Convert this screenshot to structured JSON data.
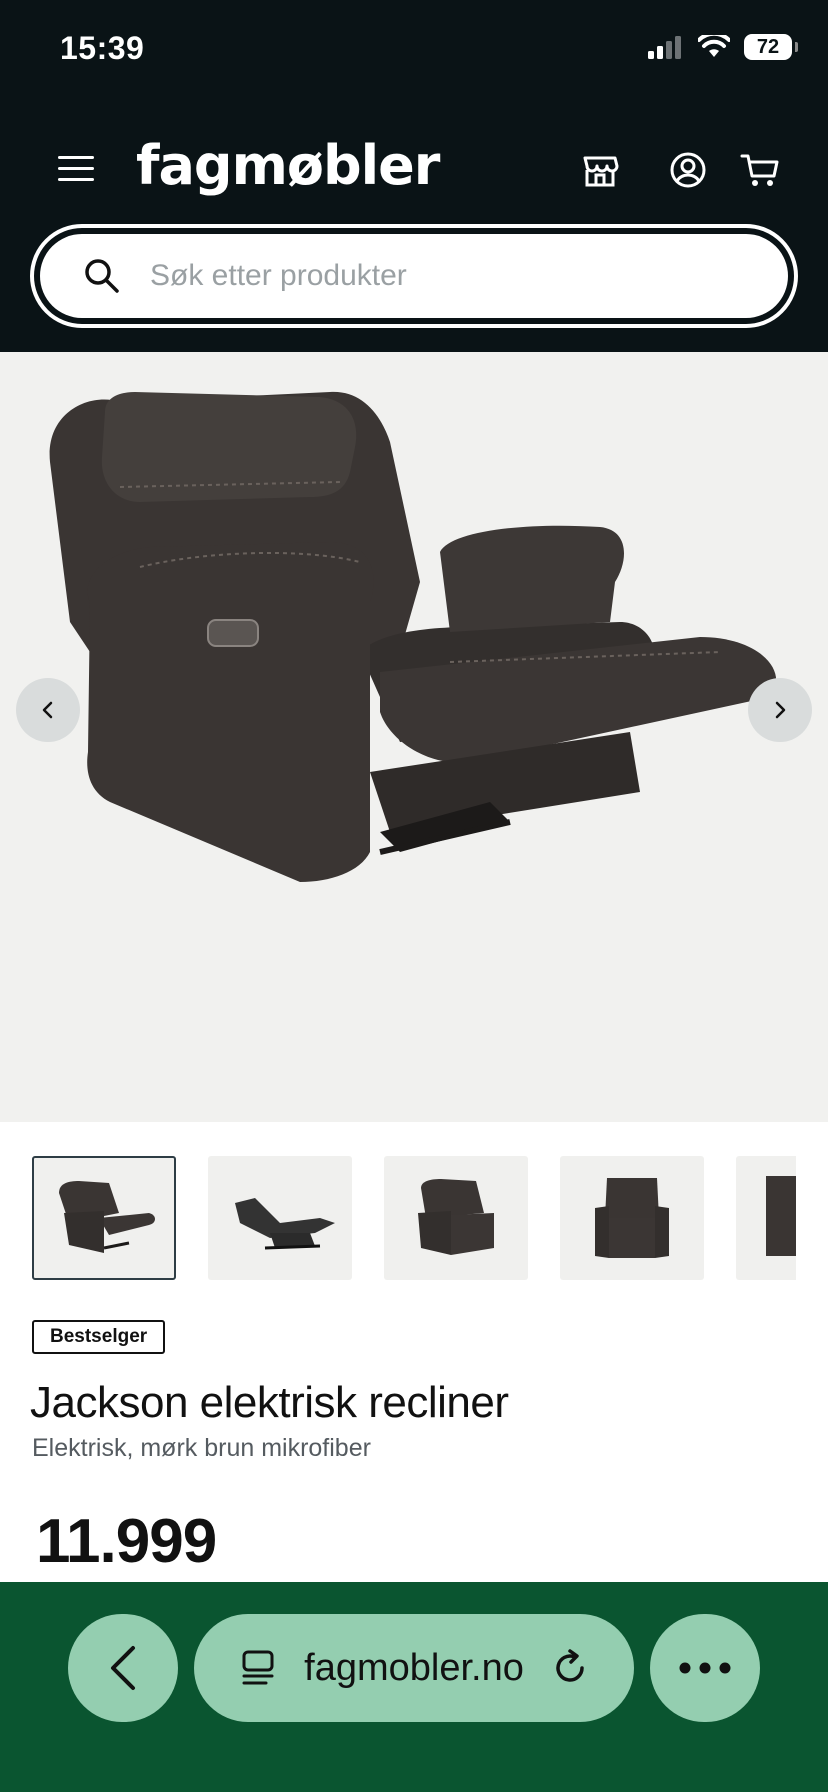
{
  "status_bar": {
    "time": "15:39",
    "battery": "72"
  },
  "header": {
    "logo": "fagmøbler",
    "search": {
      "placeholder": "Søk etter produkter",
      "value": ""
    }
  },
  "gallery": {
    "thumbnail_count_visible": 5,
    "selected_index": 0
  },
  "product": {
    "badge": "Bestselger",
    "title": "Jackson elektrisk recliner",
    "subtitle": "Elektrisk, mørk brun mikrofiber",
    "price": "11.999"
  },
  "browser": {
    "url": "fagmobler.no"
  },
  "colors": {
    "header_bg": "#0a1316",
    "hero_bg": "#f1f1ef",
    "bottom_bar_bg": "#0a5530",
    "bottom_button": "#94ceb0"
  }
}
